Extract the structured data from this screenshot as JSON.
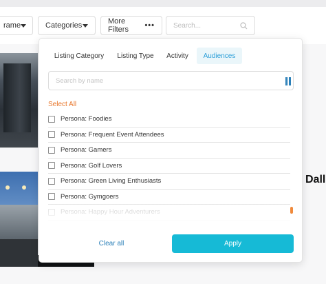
{
  "filter_bar": {
    "timeframe_label": "rame",
    "categories_label": "Categories",
    "more_filters_label": "More Filters",
    "more_filters_dots": "•••",
    "search_placeholder": "Search..."
  },
  "background": {
    "listing_title_partial": "Dall"
  },
  "popup": {
    "tabs": [
      {
        "label": "Listing Category",
        "active": false
      },
      {
        "label": "Listing Type",
        "active": false
      },
      {
        "label": "Activity",
        "active": false
      },
      {
        "label": "Audiences",
        "active": true
      }
    ],
    "search_placeholder": "Search by name",
    "select_all_label": "Select All",
    "items": [
      {
        "label": "Persona: Foodies",
        "checked": false
      },
      {
        "label": "Persona: Frequent Event Attendees",
        "checked": false
      },
      {
        "label": "Persona: Gamers",
        "checked": false
      },
      {
        "label": "Persona: Golf Lovers",
        "checked": false
      },
      {
        "label": "Persona: Green Living Enthusiasts",
        "checked": false
      },
      {
        "label": "Persona: Gymgoers",
        "checked": false
      },
      {
        "label": "Persona: Happy Hour Adventurers",
        "checked": false
      }
    ],
    "clear_all_label": "Clear all",
    "apply_label": "Apply"
  },
  "colors": {
    "accent": "#16bad6",
    "select_all": "#e8762a",
    "active_tab_text": "#2a9ed8",
    "active_tab_bg": "#eaf6fa"
  },
  "icons": [
    "chevron-down-icon",
    "more-dots-icon",
    "search-icon",
    "barcode-icon"
  ]
}
